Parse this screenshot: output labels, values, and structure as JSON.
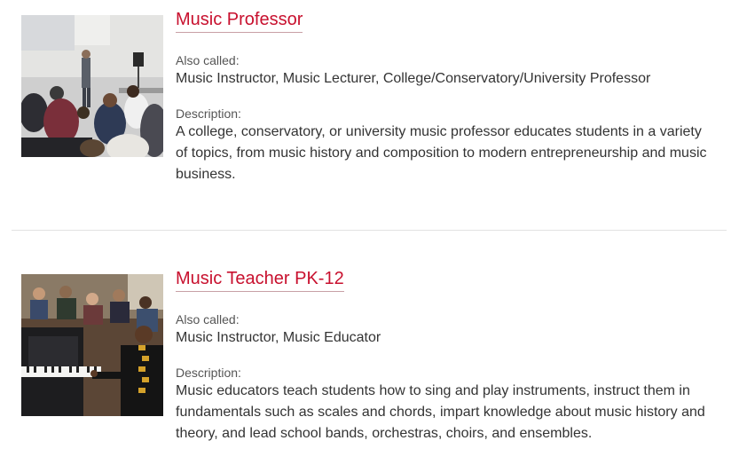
{
  "careers": [
    {
      "title": "Music Professor",
      "also_called_label": "Also called:",
      "also_called": "Music Instructor, Music Lecturer, College/Conservatory/University Professor",
      "description_label": "Description:",
      "description": "A college, conservatory, or university music professor educates students in a variety of topics, from music history and composition to modern entrepreneurship and music business.",
      "image": "lecture-hall-photo"
    },
    {
      "title": "Music Teacher PK-12",
      "also_called_label": "Also called:",
      "also_called": "Music Instructor, Music Educator",
      "description_label": "Description:",
      "description": "Music educators teach students how to sing and play instruments, instruct them in fundamentals such as scales and chords, impart knowledge about music history and theory, and lead school bands, orchestras, choirs, and ensembles.",
      "image": "piano-classroom-photo"
    }
  ],
  "colors": {
    "title_link": "#c8102e",
    "text": "#333333",
    "divider": "#e2e2e2"
  }
}
